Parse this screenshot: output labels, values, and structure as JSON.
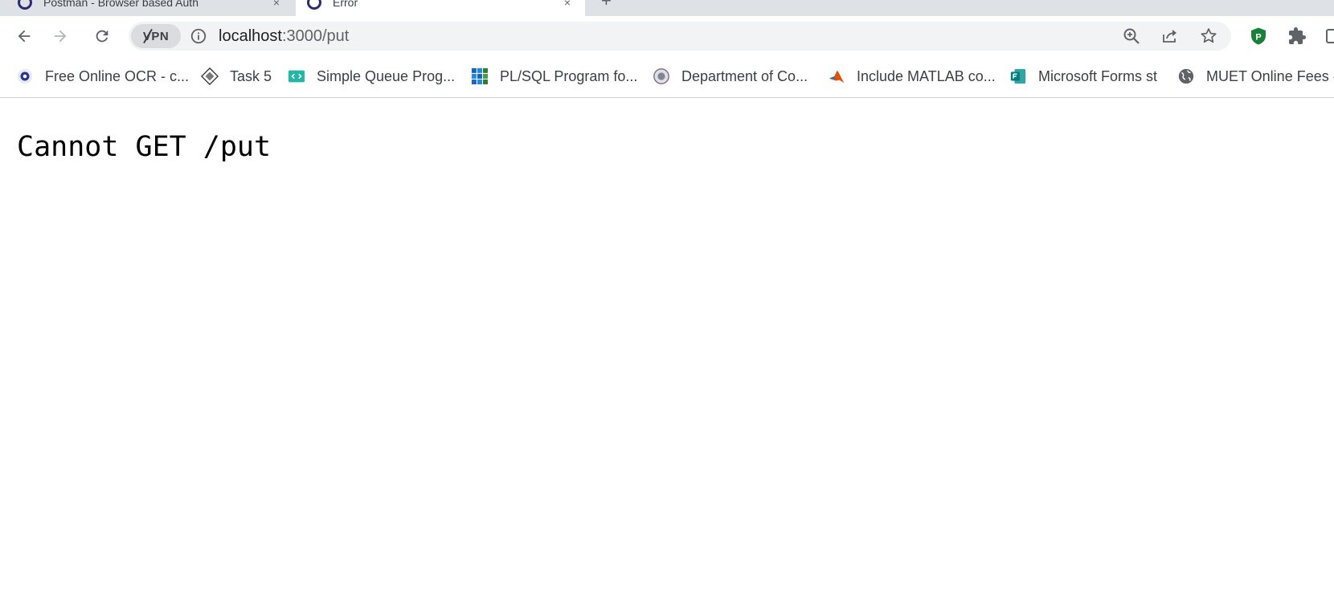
{
  "tabs": [
    {
      "title": "Postman - Browser based Auth",
      "close_symbol": "×",
      "active": false
    },
    {
      "title": "Error",
      "close_symbol": "×",
      "active": true
    }
  ],
  "new_tab_symbol": "+",
  "toolbar": {
    "back_icon": "back-arrow-icon",
    "forward_icon": "forward-arrow-icon",
    "reload_icon": "reload-icon",
    "vpn_label": "VPN"
  },
  "address_bar": {
    "host": "localhost",
    "rest": ":3000/put"
  },
  "bookmarks": [
    {
      "label": "Free Online OCR - c...",
      "icon": "ocr-site-icon"
    },
    {
      "label": "Task 5",
      "icon": "task-diamond-icon"
    },
    {
      "label": "Simple Queue Prog...",
      "icon": "code-site-icon"
    },
    {
      "label": "PL/SQL Program fo...",
      "icon": "grid-site-icon"
    },
    {
      "label": "Department of Co...",
      "icon": "department-seal-icon"
    },
    {
      "label": "Include MATLAB co...",
      "icon": "matlab-icon"
    },
    {
      "label": "Microsoft Forms st",
      "icon": "microsoft-forms-icon"
    },
    {
      "label": "MUET Online Fees -...",
      "icon": "globe-icon"
    }
  ],
  "extensions": {
    "shield_letter": "P"
  },
  "colors": {
    "tabstrip_bg": "#dee1e6",
    "omnibox_bg": "#f1f3f4",
    "shield_green": "#188038"
  },
  "page": {
    "message": "Cannot GET /put"
  }
}
